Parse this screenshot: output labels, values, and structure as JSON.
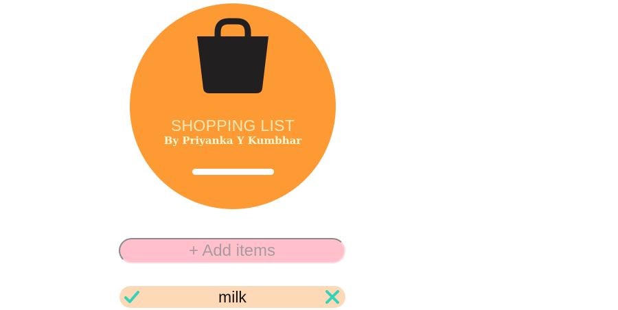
{
  "header": {
    "icon": "shopping-bag-icon",
    "title": "SHOPPING LIST",
    "byline": "By Priyanka Y Kumbhar"
  },
  "add_item": {
    "placeholder": "+ Add items",
    "value": ""
  },
  "items": [
    {
      "label": "milk",
      "check_icon": "checkmark-icon",
      "delete_icon": "close-icon"
    }
  ],
  "colors": {
    "accent": "#fd9a33",
    "icon_dark": "#221f20",
    "title_text": "#fde7b4",
    "input_background": "#ffc0cb",
    "item_background": "#fed9b8",
    "item_action": "#30d5b8"
  }
}
